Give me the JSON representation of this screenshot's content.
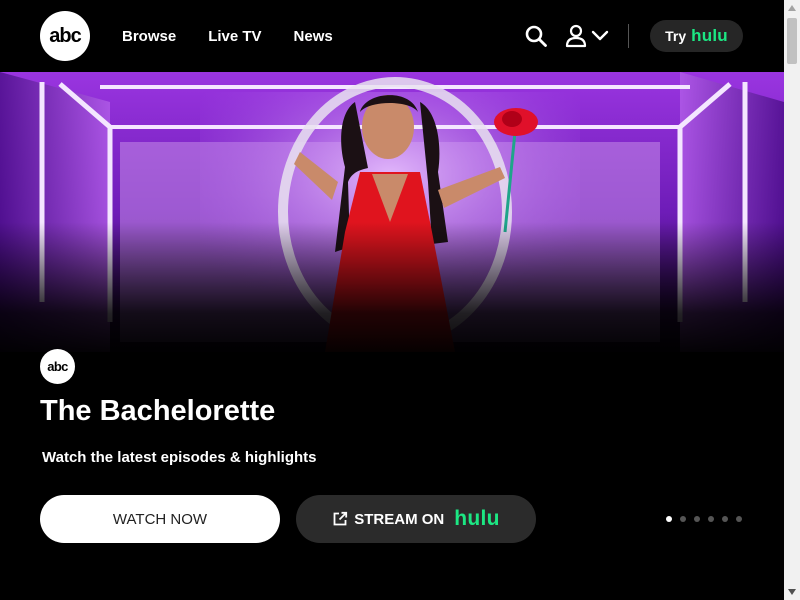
{
  "header": {
    "logo_text": "abc",
    "nav": [
      {
        "label": "Browse"
      },
      {
        "label": "Live TV"
      },
      {
        "label": "News"
      }
    ],
    "icons": [
      "search-icon",
      "user-icon",
      "chevron-down-icon"
    ],
    "try_button": {
      "prefix": "Try",
      "brand": "hulu"
    }
  },
  "hero": {
    "network_logo": "abc",
    "title": "The Bachelorette",
    "subtitle": "Watch the latest episodes & highlights",
    "primary_cta": "WATCH NOW",
    "secondary_cta": {
      "label": "STREAM ON",
      "brand": "hulu",
      "icon": "external-link-icon"
    },
    "carousel": {
      "total": 6,
      "active_index": 0
    }
  },
  "colors": {
    "brand_green": "#1ce783",
    "background": "#000000",
    "accent_purple": "#7a1fd6"
  }
}
